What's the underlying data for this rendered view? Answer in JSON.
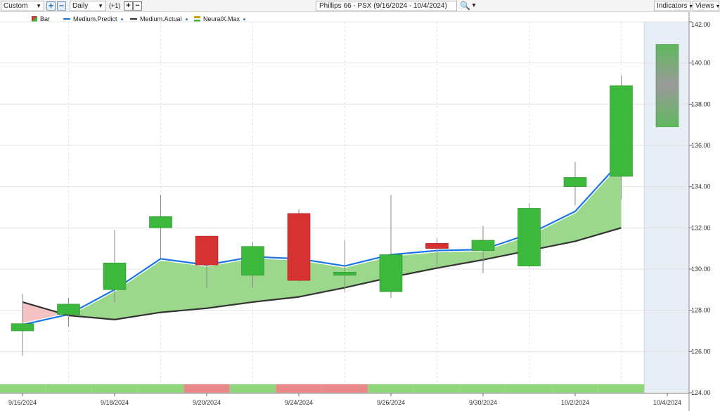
{
  "toolbar": {
    "range_select": "Custom",
    "interval_select": "Daily",
    "offset_label": "(+1)",
    "title": "Phillips 66 - PSX (9/16/2024 - 10/4/2024)",
    "indicators_label": "Indicators",
    "views_label": "Views"
  },
  "legend": [
    {
      "label": "Bar",
      "color": "#3cb83c"
    },
    {
      "label": "Medium.Predict",
      "color": "#1a73e8"
    },
    {
      "label": "Medium.Actual",
      "color": "#333333"
    },
    {
      "label": "NeuralX.Max",
      "color": "#d4a000"
    }
  ],
  "colors": {
    "up": "#3cb83c",
    "down": "#d63232",
    "predict": "#1a73e8",
    "actual": "#333333",
    "fill_up": "#9bd88b",
    "fill_down": "#f4c2c2",
    "forecast_bg": "#e8eef6",
    "strip_up": "#90d67a",
    "strip_down": "#e88a8a"
  },
  "chart_data": {
    "type": "candlestick",
    "title": "Phillips 66 - PSX (9/16/2024 - 10/4/2024)",
    "ylim": [
      124,
      142
    ],
    "y_ticks": [
      "142.00",
      "140.00",
      "138.00",
      "136.00",
      "134.00",
      "132.00",
      "130.00",
      "128.00",
      "126.00",
      "124.00"
    ],
    "x_labels": [
      {
        "index": 0,
        "label": "9/16/2024"
      },
      {
        "index": 2,
        "label": "9/18/2024"
      },
      {
        "index": 4,
        "label": "9/20/2024"
      },
      {
        "index": 6,
        "label": "9/24/2024"
      },
      {
        "index": 8,
        "label": "9/26/2024"
      },
      {
        "index": 10,
        "label": "9/30/2024"
      },
      {
        "index": 12,
        "label": "10/2/2024"
      },
      {
        "index": 14,
        "label": "10/4/2024"
      }
    ],
    "bars": [
      {
        "open": 127.0,
        "high": 128.8,
        "low": 125.8,
        "close": 127.35
      },
      {
        "open": 127.8,
        "high": 128.6,
        "low": 127.2,
        "close": 128.3
      },
      {
        "open": 129.0,
        "high": 131.9,
        "low": 128.4,
        "close": 130.3
      },
      {
        "open": 132.0,
        "high": 133.6,
        "low": 130.5,
        "close": 132.55
      },
      {
        "open": 131.6,
        "high": 131.6,
        "low": 129.1,
        "close": 130.2
      },
      {
        "open": 129.7,
        "high": 131.3,
        "low": 129.1,
        "close": 131.1
      },
      {
        "open": 132.7,
        "high": 132.9,
        "low": 129.4,
        "close": 129.45
      },
      {
        "open": 129.7,
        "high": 131.4,
        "low": 128.9,
        "close": 129.85
      },
      {
        "open": 128.9,
        "high": 133.6,
        "low": 128.6,
        "close": 130.7
      },
      {
        "open": 131.25,
        "high": 131.5,
        "low": 130.1,
        "close": 131.0
      },
      {
        "open": 130.9,
        "high": 132.1,
        "low": 129.8,
        "close": 131.4
      },
      {
        "open": 130.15,
        "high": 133.2,
        "low": 130.1,
        "close": 132.95
      },
      {
        "open": 134.0,
        "high": 135.2,
        "low": 133.1,
        "close": 134.45
      },
      {
        "open": 134.5,
        "high": 139.4,
        "low": 133.4,
        "close": 138.9
      }
    ],
    "forecast": {
      "index": 14,
      "high": 140.9,
      "low": 136.9
    },
    "series": [
      {
        "name": "Medium.Predict",
        "values": [
          127.3,
          127.8,
          129.0,
          130.5,
          130.2,
          130.6,
          130.5,
          130.15,
          130.7,
          130.9,
          130.95,
          131.7,
          132.8,
          135.25
        ]
      },
      {
        "name": "Medium.Actual",
        "values": [
          128.4,
          127.75,
          127.55,
          127.9,
          128.1,
          128.4,
          128.65,
          129.1,
          129.6,
          130.05,
          130.45,
          130.9,
          131.35,
          132.0
        ]
      }
    ],
    "signal_strip": [
      "up",
      "up",
      "up",
      "up",
      "down",
      "up",
      "down",
      "down",
      "up",
      "up",
      "up",
      "up",
      "up",
      "up"
    ]
  }
}
